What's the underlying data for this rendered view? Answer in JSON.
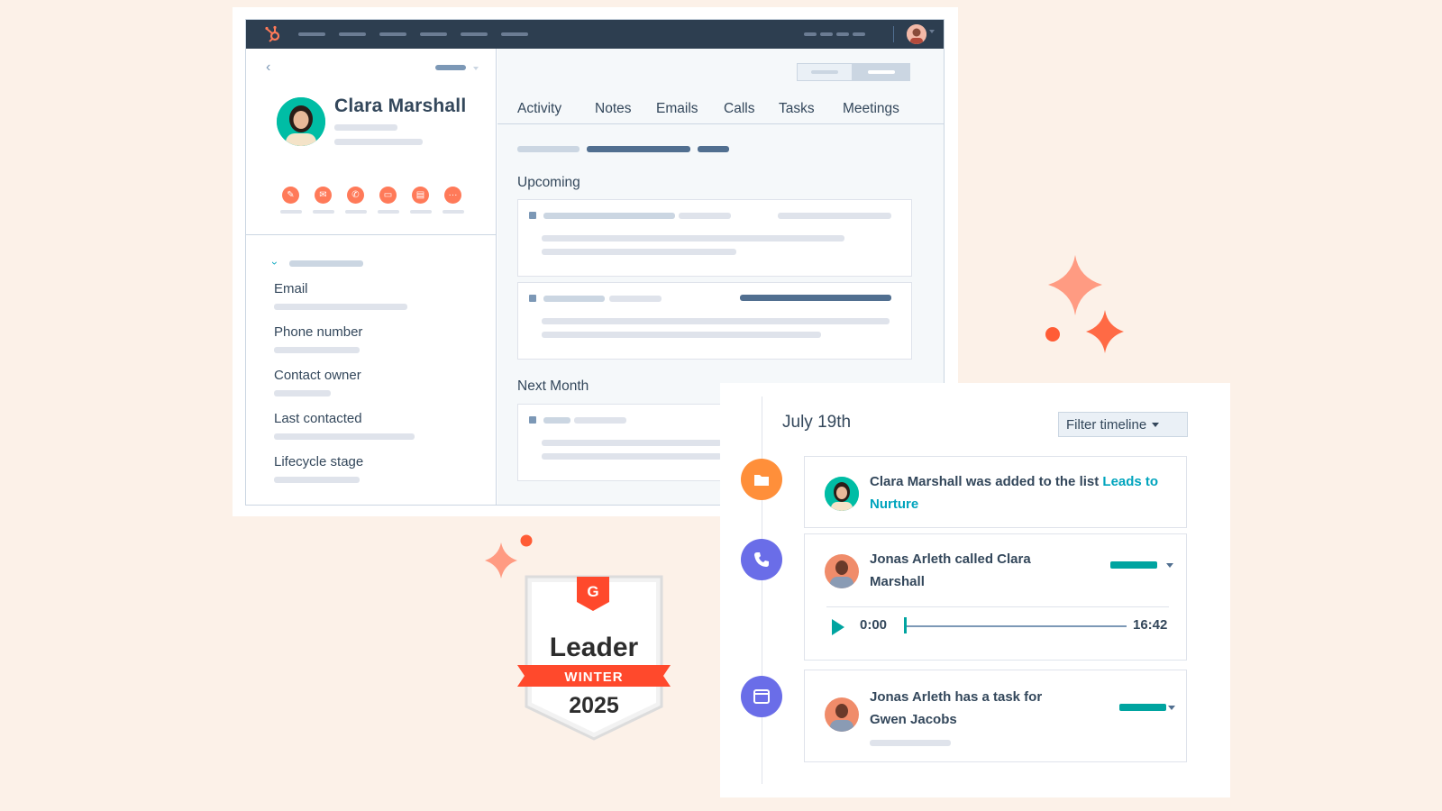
{
  "contact": {
    "name": "Clara Marshall",
    "properties": [
      {
        "label": "Email"
      },
      {
        "label": "Phone number"
      },
      {
        "label": "Contact owner"
      },
      {
        "label": "Last contacted"
      },
      {
        "label": "Lifecycle stage"
      }
    ],
    "action_icons": [
      "edit-icon",
      "email-icon",
      "phone-icon",
      "calendar-icon",
      "task-icon",
      "more-icon"
    ]
  },
  "tabs": [
    "Activity",
    "Notes",
    "Emails",
    "Calls",
    "Tasks",
    "Meetings"
  ],
  "sections": {
    "upcoming": "Upcoming",
    "next_month": "Next Month"
  },
  "timeline": {
    "date": "July 19th",
    "filter_label": "Filter timeline",
    "events": [
      {
        "icon": "folder-icon",
        "text": "Clara Marshall was added to the list ",
        "link": "Leads to Nurture"
      },
      {
        "icon": "phone-icon",
        "text": "Jonas Arleth called Clara Marshall",
        "audio": {
          "current": "0:00",
          "duration": "16:42",
          "progress": 0.0
        }
      },
      {
        "icon": "calendar-icon",
        "text": "Jonas Arleth has a task for Gwen Jacobs"
      }
    ]
  },
  "badge": {
    "brand": "G",
    "title": "Leader",
    "season": "WINTER",
    "year": "2025"
  },
  "colors": {
    "background": "#fcf1e8",
    "nav": "#2d3e50",
    "accent_orange": "#ff7a59",
    "accent_teal": "#00a4bd",
    "icon_purple": "#6a6de8",
    "badge_red": "#ff492c"
  }
}
